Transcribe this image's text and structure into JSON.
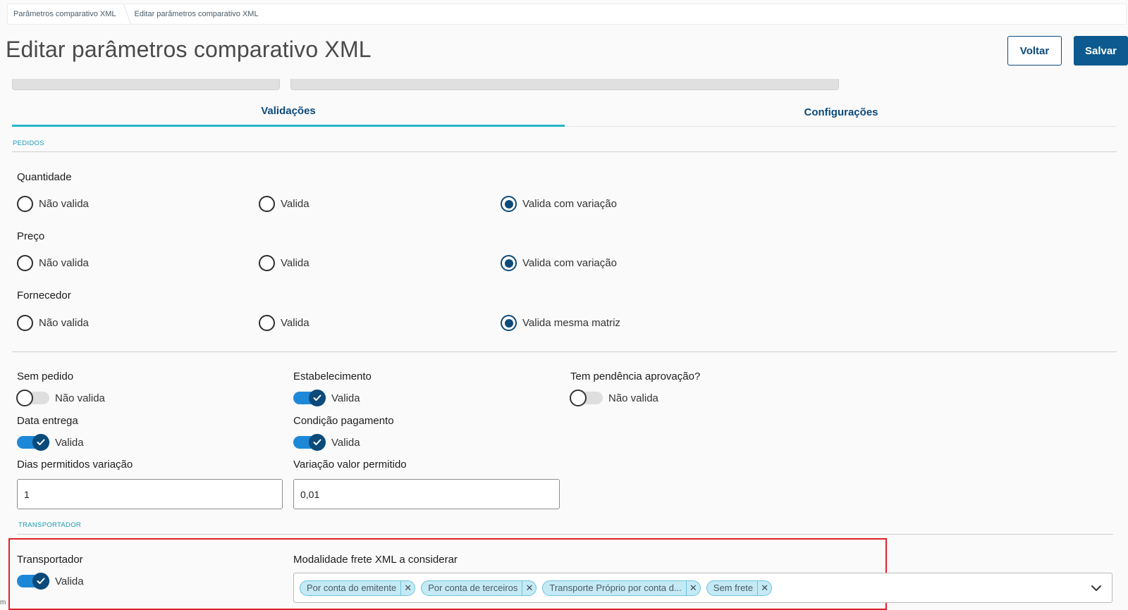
{
  "breadcrumb": [
    "Parâmetros comparativo XML",
    "Editar parâmetros comparativo XML"
  ],
  "page": {
    "title": "Editar parâmetros comparativo XML"
  },
  "actions": {
    "back": "Voltar",
    "save": "Salvar"
  },
  "tabs": [
    {
      "label": "Validações",
      "active": true
    },
    {
      "label": "Configurações",
      "active": false
    }
  ],
  "sections": {
    "pedidos": "PEDIDOS",
    "transportador": "TRANSPORTADOR"
  },
  "radio_groups": [
    {
      "label": "Quantidade",
      "options": [
        "Não valida",
        "Valida",
        "Valida com variação"
      ],
      "selected": 2
    },
    {
      "label": "Preço",
      "options": [
        "Não valida",
        "Valida",
        "Valida com variação"
      ],
      "selected": 2
    },
    {
      "label": "Fornecedor",
      "options": [
        "Não valida",
        "Valida",
        "Valida mesma matriz"
      ],
      "selected": 2
    }
  ],
  "switches": {
    "sem_pedido": {
      "label": "Sem pedido",
      "state": "Não valida",
      "on": false
    },
    "estabelecimento": {
      "label": "Estabelecimento",
      "state": "Valida",
      "on": true
    },
    "pendencia": {
      "label": "Tem pendência aprovação?",
      "state": "Não valida",
      "on": false
    },
    "data_entrega": {
      "label": "Data entrega",
      "state": "Valida",
      "on": true
    },
    "condicao": {
      "label": "Condição pagamento",
      "state": "Valida",
      "on": true
    },
    "transportador": {
      "label": "Transportador",
      "state": "Valida",
      "on": true
    }
  },
  "inputs": {
    "dias": {
      "label": "Dias permitidos variação",
      "value": "1"
    },
    "variacao": {
      "label": "Variação valor permitido",
      "value": "0,01"
    }
  },
  "modalidade": {
    "label": "Modalidade frete XML a considerar",
    "chips": [
      "Por conta do emitente",
      "Por conta de terceiros",
      "Transporte Próprio por conta d...",
      "Sem frete"
    ]
  },
  "corner_text": "m",
  "colors": {
    "primary": "#0c5a8f",
    "accent": "#29b6c9",
    "switch_on": "#1e88d8",
    "highlight": "#e0202a"
  }
}
